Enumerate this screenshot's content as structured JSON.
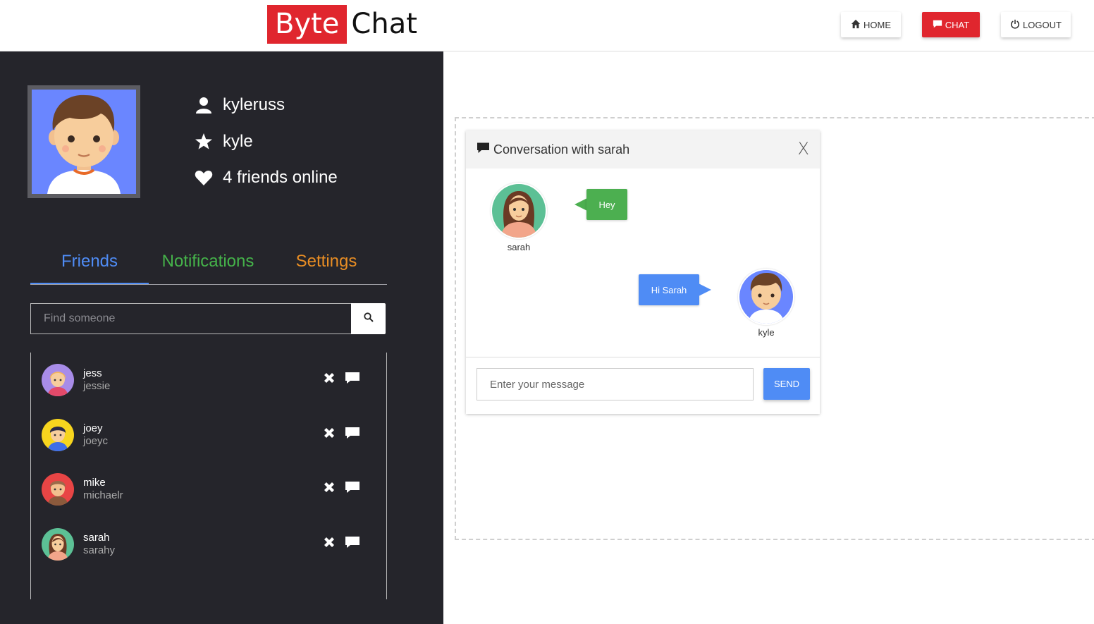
{
  "header": {
    "logo_part1": "Byte",
    "logo_part2": "Chat",
    "nav": [
      {
        "label": "HOME",
        "icon": "home-icon"
      },
      {
        "label": "CHAT",
        "icon": "chat-icon"
      },
      {
        "label": "LOGOUT",
        "icon": "power-icon"
      }
    ]
  },
  "profile": {
    "username": "kyleruss",
    "display_name": "kyle",
    "friends_online": "4 friends online"
  },
  "tabs": [
    "Friends",
    "Notifications",
    "Settings"
  ],
  "search": {
    "placeholder": "Find someone"
  },
  "friends": [
    {
      "name": "jess",
      "username": "jessie"
    },
    {
      "name": "joey",
      "username": "joeyc"
    },
    {
      "name": "mike",
      "username": "michaelr"
    },
    {
      "name": "sarah",
      "username": "sarahy"
    }
  ],
  "conversation": {
    "title": "Conversation with sarah",
    "close": "X",
    "messages": [
      {
        "sender": "sarah",
        "text": "Hey"
      },
      {
        "sender": "kyle",
        "text": "Hi Sarah"
      }
    ],
    "input_placeholder": "Enter your message",
    "send_label": "SEND"
  },
  "colors": {
    "brand_red": "#e0262e",
    "sidebar_bg": "#25252b",
    "accent_blue": "#4f8cf5",
    "accent_green": "#45b34a",
    "accent_orange": "#e88d24"
  }
}
